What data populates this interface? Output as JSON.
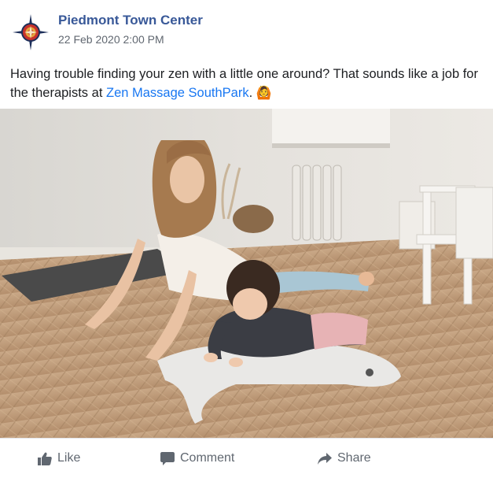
{
  "post": {
    "page_name": "Piedmont Town Center",
    "timestamp": "22 Feb 2020 2:00 PM",
    "text_before": "Having trouble finding your zen with a little one around? That sounds like a job for the therapists at ",
    "link_text": "Zen Massage SouthPark",
    "text_after": ". ",
    "emoji": "🙆"
  },
  "photo": {
    "subject": "woman-and-toddler-yoga-photo"
  },
  "actions": {
    "like_label": "Like",
    "comment_label": "Comment",
    "share_label": "Share"
  },
  "colors": {
    "page_name": "#385898",
    "link": "#1877f2",
    "muted": "#606770",
    "logo_red": "#c8322b",
    "logo_navy": "#1d2f5a"
  }
}
